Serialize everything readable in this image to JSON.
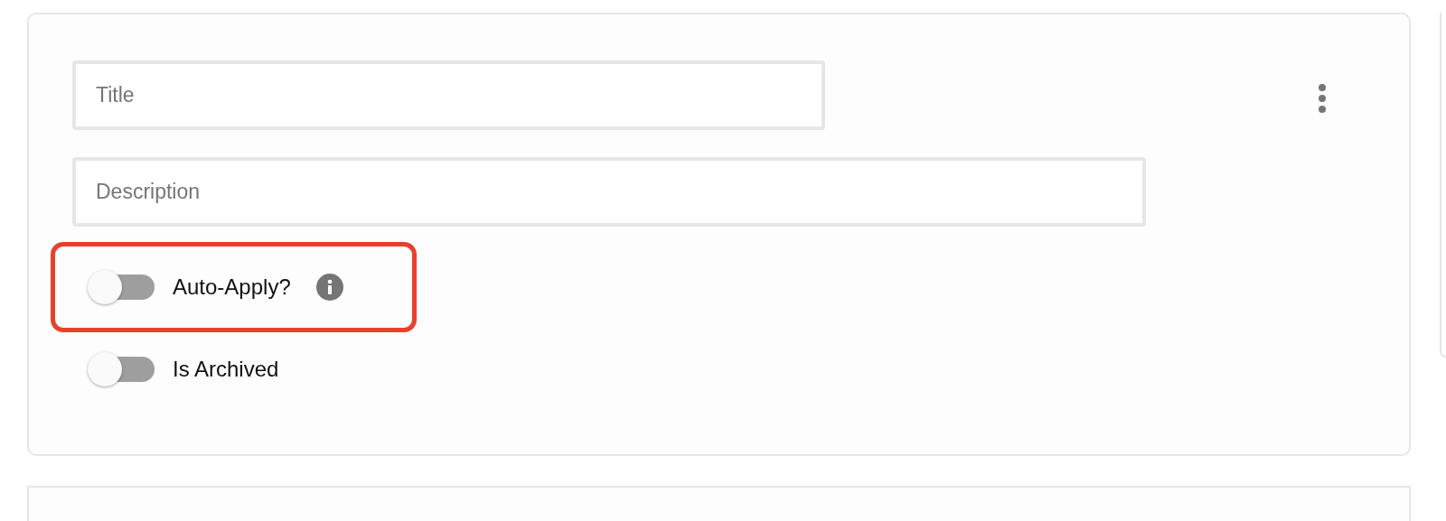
{
  "fields": [
    {
      "placeholder": "Title"
    },
    {
      "placeholder": "Description"
    }
  ],
  "toggles": [
    {
      "label": "Auto-Apply?",
      "on": false,
      "info": true,
      "highlighted": true
    },
    {
      "label": "Is Archived",
      "on": false,
      "info": false,
      "highlighted": false
    }
  ]
}
